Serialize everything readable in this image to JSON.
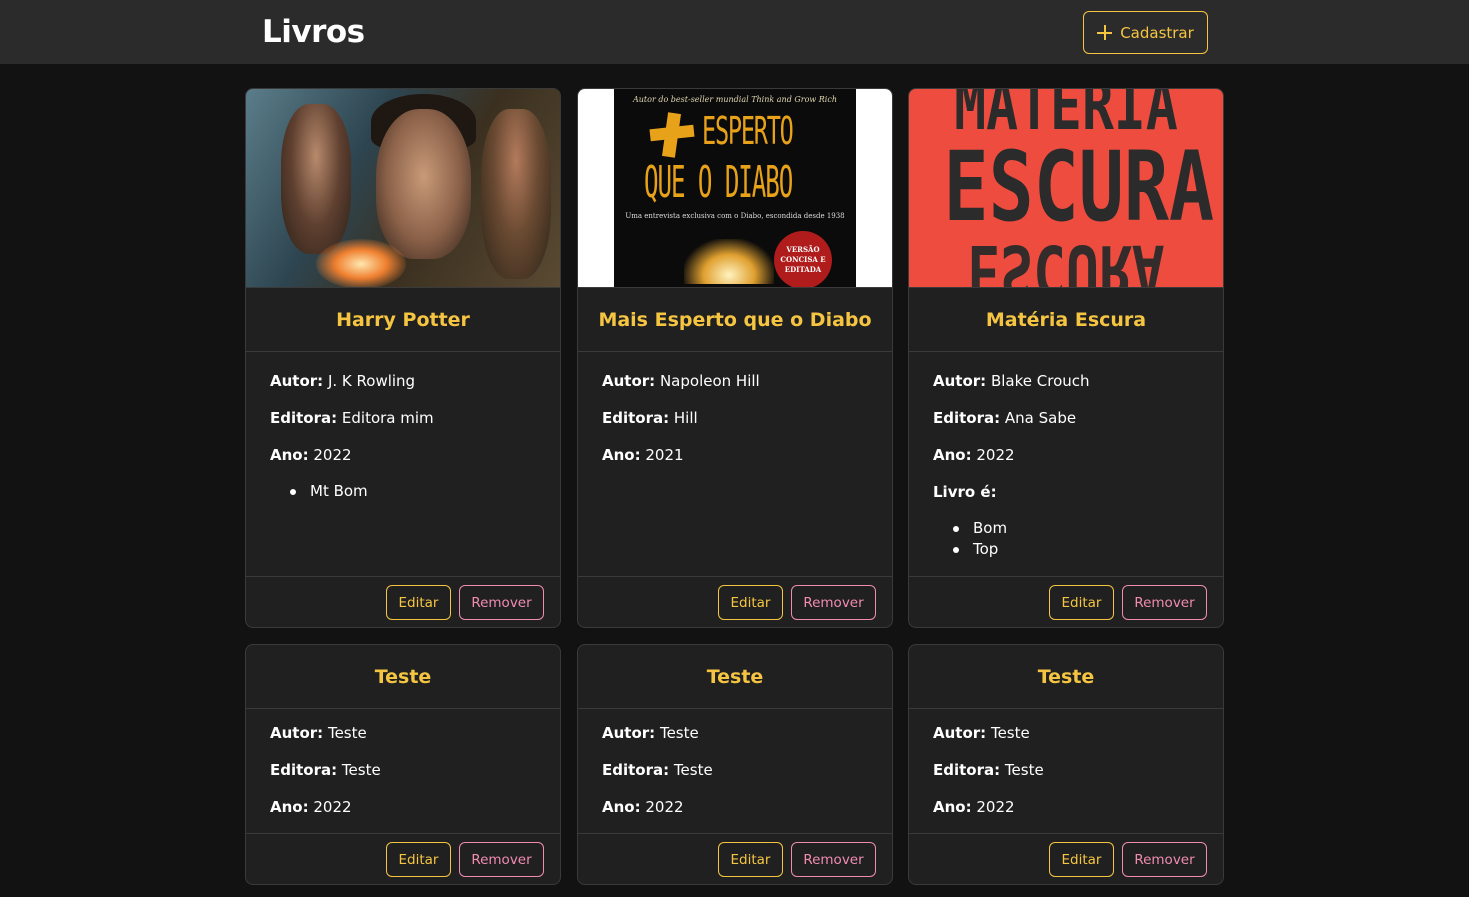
{
  "header": {
    "title": "Livros",
    "add_button_label": "Cadastrar",
    "add_icon": "plus-icon"
  },
  "labels": {
    "author": "Autor:",
    "publisher": "Editora:",
    "year": "Ano:",
    "edit": "Editar",
    "remove": "Remover"
  },
  "books": [
    {
      "title": "Harry Potter",
      "author": "J. K Rowling",
      "publisher": "Editora mim",
      "year": "2022",
      "tags_label": "",
      "tags": [
        "Mt Bom"
      ]
    },
    {
      "title": "Mais Esperto que o Diabo",
      "author": "Napoleon Hill",
      "publisher": "Hill",
      "year": "2021",
      "cover_text": {
        "top": "Autor do best-seller mundial Think and Grow Rich",
        "title_line1": "ESPERTO",
        "title_line2": "QUE O DIABO",
        "subtitle": "Uma entrevista exclusiva com o Diabo, escondida desde 1938",
        "seal": "VERSÃO CONCISA E EDITADA"
      }
    },
    {
      "title": "Matéria Escura",
      "author": "Blake Crouch",
      "publisher": "Ana Sabe",
      "year": "2022",
      "tags_label": "Livro é:",
      "tags": [
        "Bom",
        "Top"
      ],
      "cover_text": {
        "line1": "MATÉRIA",
        "line2": "ESCURA",
        "line3": "ESCURA"
      }
    },
    {
      "title": "Teste",
      "author": "Teste",
      "publisher": "Teste",
      "year": "2022"
    },
    {
      "title": "Teste",
      "author": "Teste",
      "publisher": "Teste",
      "year": "2022"
    },
    {
      "title": "Teste",
      "author": "Teste",
      "publisher": "Teste",
      "year": "2022"
    }
  ],
  "colors": {
    "accent": "#f5c542",
    "danger": "#f08cb0",
    "card_bg": "#202020",
    "page_bg": "#121212",
    "topbar_bg": "#2b2b2b"
  }
}
